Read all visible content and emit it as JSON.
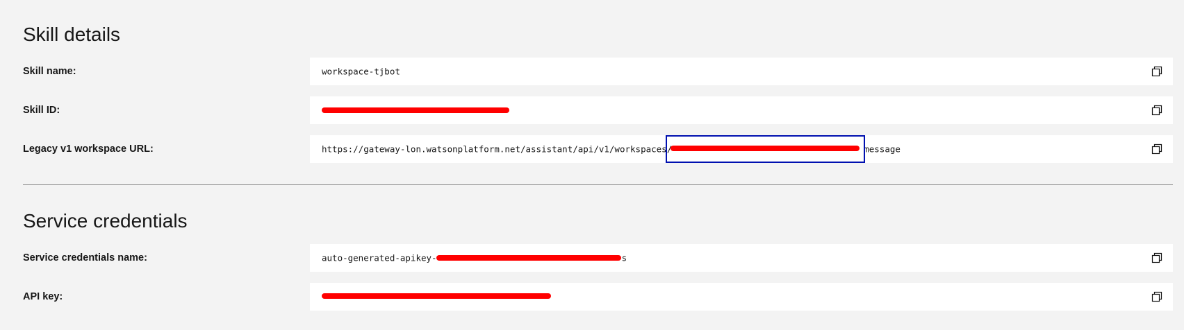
{
  "skill_details": {
    "title": "Skill details",
    "skill_name": {
      "label": "Skill name:",
      "value": "workspace-tjbot"
    },
    "skill_id": {
      "label": "Skill ID:",
      "value": ""
    },
    "legacy_url": {
      "label": "Legacy v1 workspace URL:",
      "value_prefix": "https://gateway-lon.watsonplatform.net/assistant/api/v1/workspaces/",
      "value_suffix": "message"
    }
  },
  "service_credentials": {
    "title": "Service credentials",
    "credentials_name": {
      "label": "Service credentials name:",
      "value_prefix": "auto-generated-apikey-",
      "value_suffix": "s"
    },
    "api_key": {
      "label": "API key:",
      "value": ""
    }
  },
  "icons": {
    "copy": "copy-icon"
  },
  "colors": {
    "background": "#f3f3f3",
    "field_background": "#ffffff",
    "redaction": "#ff0000",
    "highlight_box": "#0010b0",
    "divider": "#8d8d8d"
  }
}
